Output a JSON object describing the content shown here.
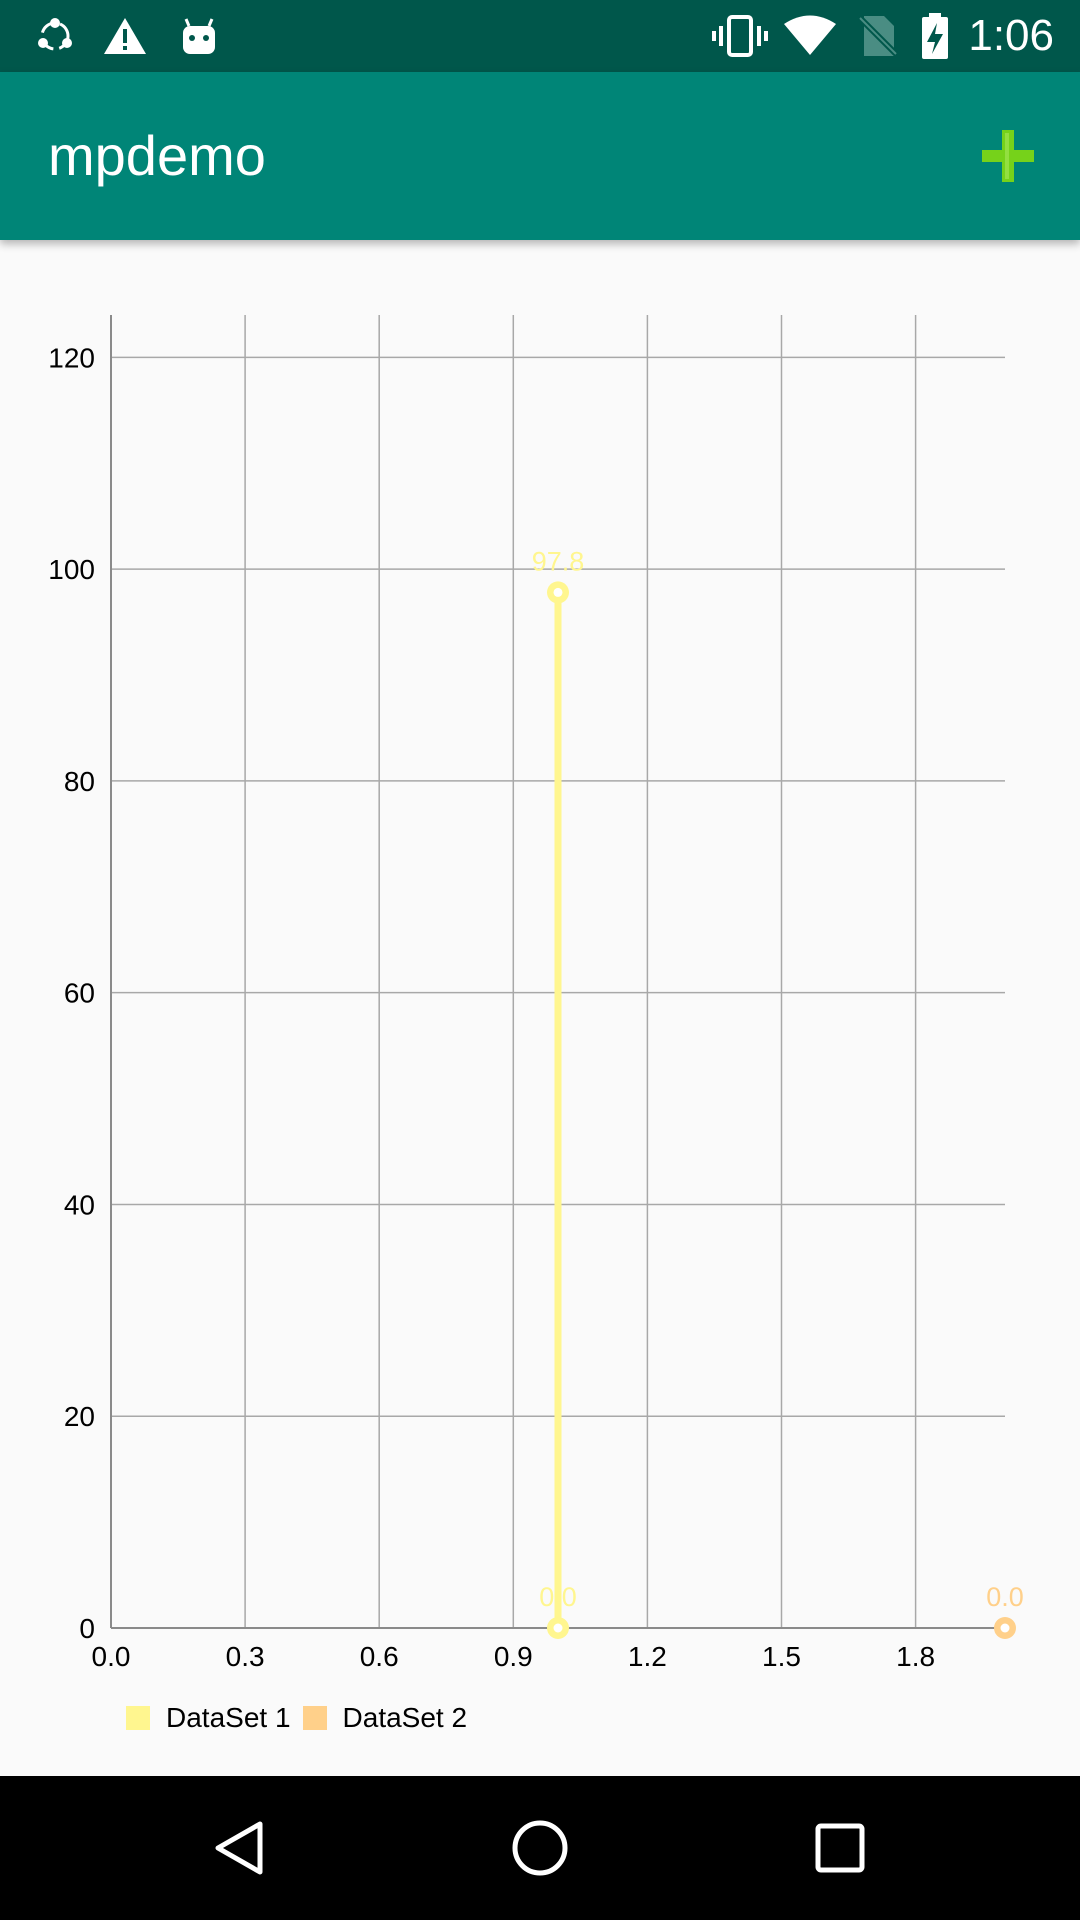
{
  "status_bar": {
    "time": "1:06",
    "icons": [
      "sync-icon",
      "warning-icon",
      "android-icon",
      "vibrate-icon",
      "wifi-icon",
      "no-sim-icon",
      "battery-charging-icon"
    ]
  },
  "app_bar": {
    "title": "mpdemo",
    "action_icon": "add-icon",
    "action_color": "#76d21a"
  },
  "chart_data": {
    "type": "line",
    "title": "",
    "xlabel": "",
    "ylabel": "",
    "xlim": [
      0.0,
      2.0
    ],
    "ylim": [
      0,
      124
    ],
    "x_ticks": [
      "0.0",
      "0.3",
      "0.6",
      "0.9",
      "1.2",
      "1.5",
      "1.8"
    ],
    "y_ticks": [
      "0",
      "20",
      "40",
      "60",
      "80",
      "100",
      "120"
    ],
    "grid": true,
    "legend_position": "bottom-left",
    "series": [
      {
        "name": "DataSet 1",
        "color": "#fff68f",
        "points": [
          {
            "x": 1.0,
            "y": 0.0,
            "label": "0.0"
          },
          {
            "x": 1.0,
            "y": 97.8,
            "label": "97.8"
          }
        ]
      },
      {
        "name": "DataSet 2",
        "color": "#ffd08a",
        "points": [
          {
            "x": 2.0,
            "y": 0.0,
            "label": "0.0"
          }
        ]
      }
    ]
  },
  "nav_bar": {
    "buttons": [
      "back-icon",
      "home-icon",
      "recents-icon"
    ]
  }
}
